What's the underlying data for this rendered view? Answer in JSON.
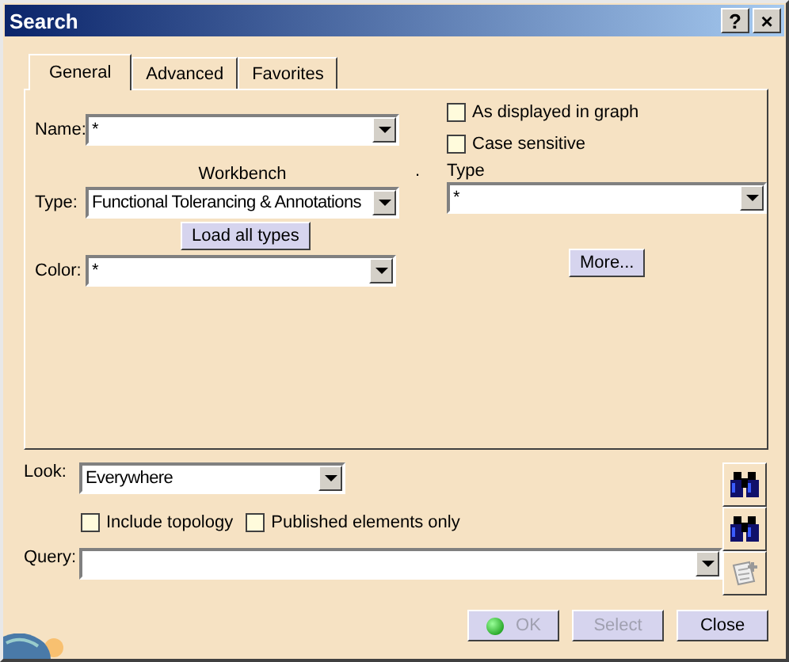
{
  "window": {
    "title": "Search",
    "help": "?",
    "close": "×"
  },
  "tabs": [
    {
      "label": "General",
      "selected": true
    },
    {
      "label": "Advanced",
      "selected": false
    },
    {
      "label": "Favorites",
      "selected": false
    }
  ],
  "general": {
    "name": {
      "label": "Name:",
      "value": "*"
    },
    "as_displayed": {
      "label": "As displayed in graph",
      "checked": false
    },
    "case_sensitive": {
      "label": "Case sensitive",
      "checked": false
    },
    "workbench_heading": "Workbench",
    "separator": ".",
    "type_heading": "Type",
    "type": {
      "label": "Type:",
      "value": "Functional Tolerancing & Annotations"
    },
    "type_value": "*",
    "load_button": "Load all types",
    "color": {
      "label": "Color:",
      "value": "*"
    },
    "more_button": "More..."
  },
  "look": {
    "label": "Look:",
    "value": "Everywhere"
  },
  "include_topology": {
    "label": "Include topology",
    "checked": false
  },
  "published_only": {
    "label": "Published elements only",
    "checked": false
  },
  "query": {
    "label": "Query:"
  },
  "buttons": [
    {
      "label": "OK",
      "disabled": true,
      "kind": "ok"
    },
    {
      "label": "Select",
      "disabled": true,
      "kind": "plain"
    },
    {
      "label": "Close",
      "disabled": false,
      "kind": "plain"
    }
  ]
}
